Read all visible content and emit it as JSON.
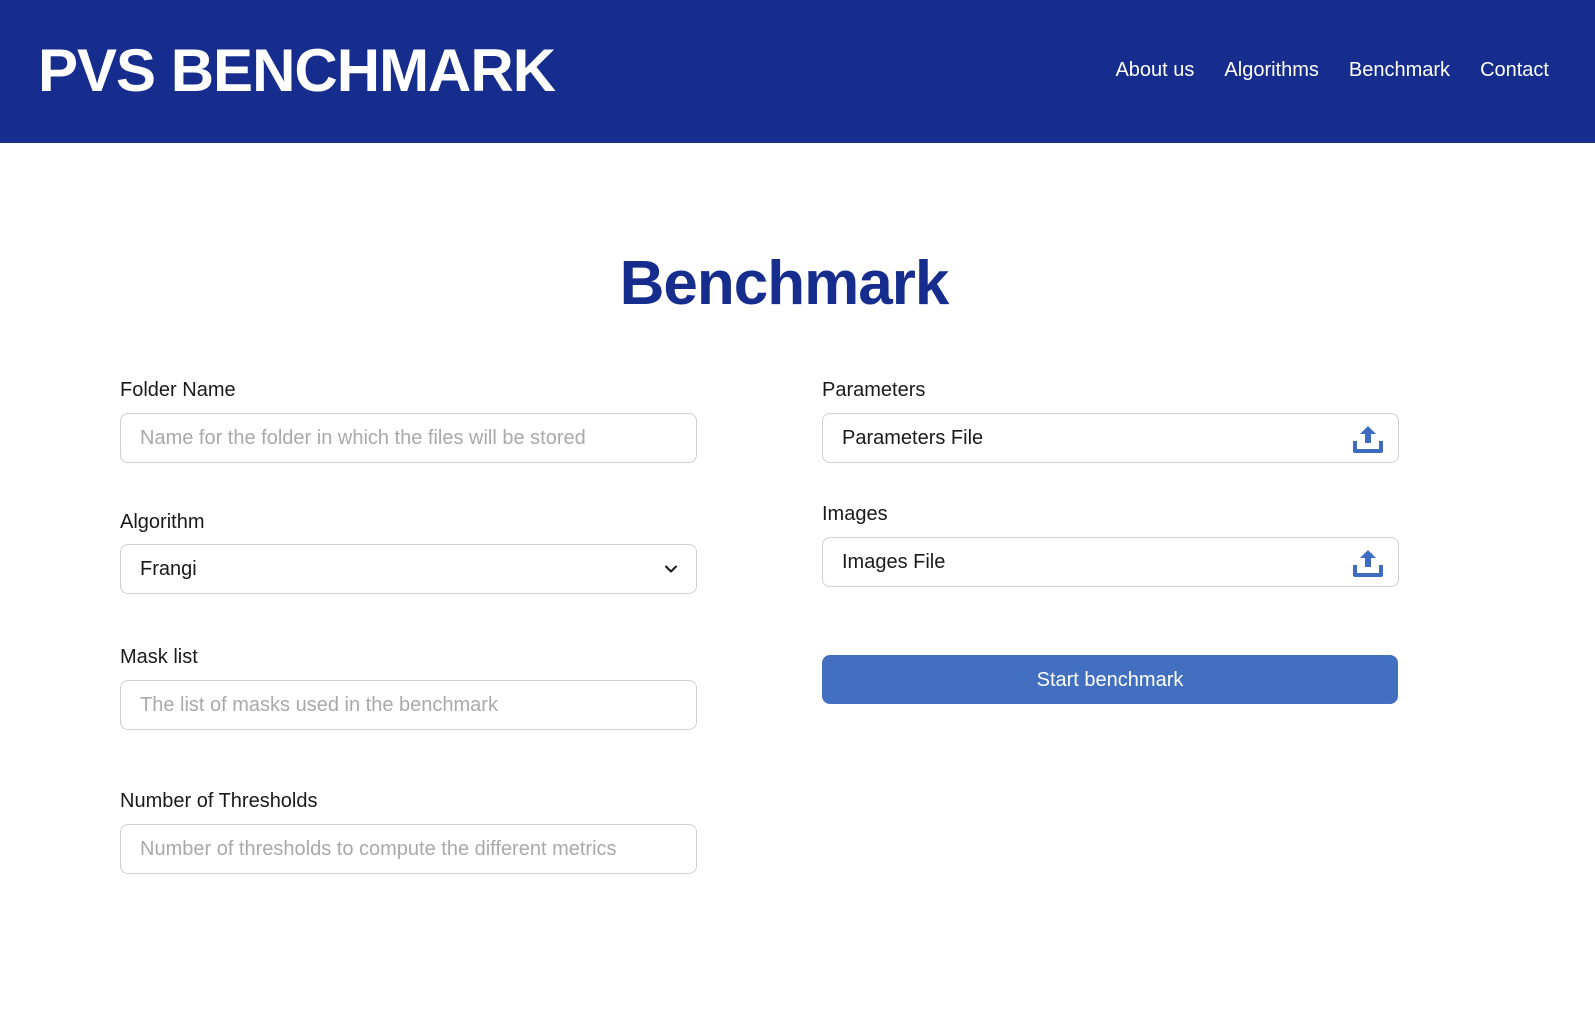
{
  "header": {
    "brand": "PVS BENCHMARK",
    "nav": [
      "About us",
      "Algorithms",
      "Benchmark",
      "Contact"
    ]
  },
  "page": {
    "title": "Benchmark"
  },
  "form": {
    "folder_name": {
      "label": "Folder Name",
      "placeholder": "Name for the folder in which the files will be stored",
      "value": ""
    },
    "algorithm": {
      "label": "Algorithm",
      "selected": "Frangi"
    },
    "mask_list": {
      "label": "Mask list",
      "placeholder": "The list of masks used in the benchmark",
      "value": ""
    },
    "thresholds": {
      "label": "Number of Thresholds",
      "placeholder": "Number of thresholds to compute the different metrics",
      "value": ""
    },
    "parameters": {
      "label": "Parameters",
      "file_text": "Parameters File",
      "icon": "upload-icon"
    },
    "images": {
      "label": "Images",
      "file_text": "Images File",
      "icon": "upload-icon"
    },
    "submit_label": "Start benchmark"
  },
  "colors": {
    "header_bg": "#162d8e",
    "title": "#162d8e",
    "button_bg": "#426fbf",
    "icon": "#3e6cc0"
  }
}
